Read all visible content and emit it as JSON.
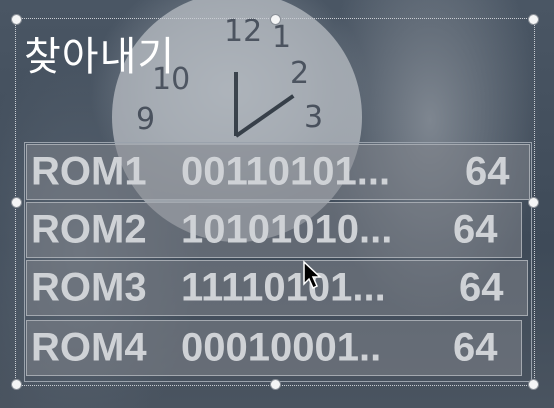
{
  "title": "찾아내기",
  "rows": [
    {
      "name": "ROM1",
      "bits": "00110101...",
      "value": "64"
    },
    {
      "name": "ROM2",
      "bits": "10101010...",
      "value": "64"
    },
    {
      "name": "ROM3",
      "bits": "11110101...",
      "value": "64"
    },
    {
      "name": "ROM4",
      "bits": "00010001..",
      "value": "64"
    }
  ],
  "clock": {
    "numbers": [
      "12",
      "1",
      "2",
      "3",
      "10",
      "9"
    ]
  }
}
